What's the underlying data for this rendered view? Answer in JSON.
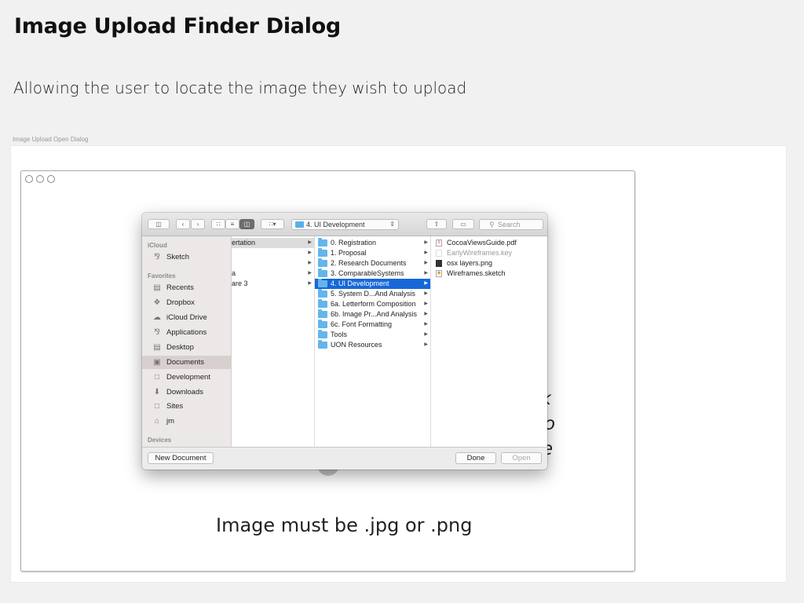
{
  "page": {
    "title": "Image Upload Finder Dialog",
    "description": "Allowing the user to locate the image they wish to upload",
    "caption": "Image Upload Open Dialog"
  },
  "mockup": {
    "hint_lines": [
      "ck",
      "to",
      "e"
    ],
    "requirement": "Image must be .jpg or .png"
  },
  "dialog": {
    "path": "4. UI Development",
    "search_placeholder": "Search",
    "sidebar": {
      "sections": [
        {
          "heading": "iCloud",
          "items": [
            {
              "label": "Sketch",
              "icon": "app-icon"
            }
          ]
        },
        {
          "heading": "Favorites",
          "items": [
            {
              "label": "Recents",
              "icon": "recents-icon"
            },
            {
              "label": "Dropbox",
              "icon": "dropbox-icon"
            },
            {
              "label": "iCloud Drive",
              "icon": "cloud-icon"
            },
            {
              "label": "Applications",
              "icon": "applications-icon"
            },
            {
              "label": "Desktop",
              "icon": "desktop-icon"
            },
            {
              "label": "Documents",
              "icon": "documents-icon",
              "selected": true
            },
            {
              "label": "Development",
              "icon": "folder-icon"
            },
            {
              "label": "Downloads",
              "icon": "downloads-icon"
            },
            {
              "label": "Sites",
              "icon": "folder-icon"
            },
            {
              "label": "jm",
              "icon": "home-icon"
            }
          ]
        },
        {
          "heading": "Devices",
          "items": []
        }
      ]
    },
    "column1": [
      "ertation",
      "",
      "",
      "a",
      "are 3"
    ],
    "column2": [
      {
        "label": "0. Registration"
      },
      {
        "label": "1. Proposal"
      },
      {
        "label": "2. Research Documents"
      },
      {
        "label": "3. ComparableSystems"
      },
      {
        "label": "4. UI Development",
        "selected": true
      },
      {
        "label": "5. System D...And Analysis"
      },
      {
        "label": "6a. Letterform Composition"
      },
      {
        "label": "6b. Image Pr...And Analysis"
      },
      {
        "label": "6c. Font Formatting"
      },
      {
        "label": "Tools"
      },
      {
        "label": "UON Resources"
      }
    ],
    "column3": [
      {
        "label": "CocoaViewsGuide.pdf",
        "icon": "pdf-file-icon"
      },
      {
        "label": "EarlyWireframes.key",
        "icon": "keynote-file-icon",
        "dimmed": true
      },
      {
        "label": "osx layers.png",
        "icon": "image-file-icon"
      },
      {
        "label": "Wireframes.sketch",
        "icon": "sketch-file-icon"
      }
    ],
    "buttons": {
      "new_document": "New Document",
      "done": "Done",
      "open": "Open"
    }
  }
}
